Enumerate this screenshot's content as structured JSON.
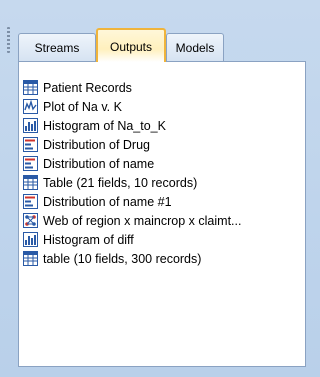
{
  "tabs": [
    {
      "label": "Streams"
    },
    {
      "label": "Outputs"
    },
    {
      "label": "Models"
    }
  ],
  "active_tab": "Outputs",
  "outputs": [
    {
      "label": "Patient Records",
      "icon": "table-icon"
    },
    {
      "label": "Plot of Na v. K",
      "icon": "plot-icon"
    },
    {
      "label": "Histogram of Na_to_K",
      "icon": "histogram-icon"
    },
    {
      "label": "Distribution of Drug",
      "icon": "distribution-icon"
    },
    {
      "label": "Distribution of name",
      "icon": "distribution-icon"
    },
    {
      "label": "Table (21 fields, 10 records)",
      "icon": "table-icon"
    },
    {
      "label": "Distribution of name #1",
      "icon": "distribution-icon"
    },
    {
      "label": "Web of region x maincrop x claimt...",
      "icon": "web-icon"
    },
    {
      "label": "Histogram of diff",
      "icon": "histogram-icon"
    },
    {
      "label": "table (10 fields, 300 records)",
      "icon": "table-icon"
    }
  ],
  "colors": {
    "panel_bg": "#c6d9ee",
    "active_tab_border": "#f0b43b",
    "icon_blue": "#2a5aa6",
    "icon_red": "#d0342c"
  }
}
